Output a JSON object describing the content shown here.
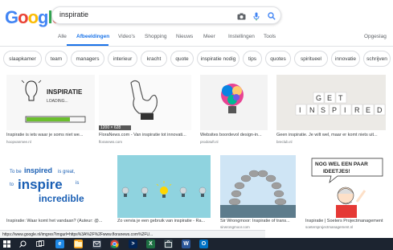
{
  "logo": {
    "letters": [
      "G",
      "o",
      "o",
      "g",
      "l",
      "e"
    ],
    "colors": [
      "#4285F4",
      "#EA4335",
      "#FBBC05",
      "#4285F4",
      "#34A853",
      "#EA4335"
    ]
  },
  "search": {
    "query": "inspiratie"
  },
  "tabs": [
    {
      "label": "Alle"
    },
    {
      "label": "Afbeeldingen"
    },
    {
      "label": "Video's"
    },
    {
      "label": "Shopping"
    },
    {
      "label": "Nieuws"
    },
    {
      "label": "Meer"
    },
    {
      "label": "Instellingen"
    },
    {
      "label": "Tools"
    },
    {
      "label": "Opgeslag"
    }
  ],
  "chips": [
    "slaapkamer",
    "team",
    "managers",
    "interieur",
    "kracht",
    "quote",
    "inspiratie nodig",
    "tips",
    "quotes",
    "spiritueel",
    "innovatie",
    "schrijven"
  ],
  "results": [
    {
      "caption": "Inspiratie is iets waar je soms niet we...",
      "source": "hoopvanmee.nl",
      "thumb_text": "INSPIRATIE LOADING..."
    },
    {
      "caption": "FloraNews.com - Van inspiratie tot innovati...",
      "source": "floranews.com",
      "thumb_text": "1200 × 628"
    },
    {
      "caption": "Websites boordevol design-in...",
      "source": "prodotuft.nl",
      "thumb_text": ""
    },
    {
      "caption": "Geen inspiratie. Je wilt wel, maar er komt niets uit...",
      "source": "breclub.nl",
      "thumb_text": "GET INSPIRED"
    },
    {
      "caption": "Inspiratie: Waar komt het vandaan? (Auteur: @...",
      "source": "",
      "thumb_text": "To be inspired is great, to inspire is incredible"
    },
    {
      "caption": "Zo vervia je een gebruik van inspiratie - Ra...",
      "source": "",
      "thumb_text": ""
    },
    {
      "caption": "Sir Wrongmoor: Inspiratie of trans...",
      "source": "sirwrongmoor.com",
      "thumb_text": ""
    },
    {
      "caption": "Inspiratie | Soeters Projectmanagement",
      "source": "soetersprojectmanagement.nl",
      "thumb_text": "NOG WEL EEN PAAR IDEETJES!"
    }
  ],
  "status_url": "https://www.google.nl/imgres?imgurl=https%3A%2F%2Fwww.floranews.com%2FU...",
  "taskbar": [
    "start-icon",
    "search-icon",
    "task-view-icon",
    "edge-icon",
    "explorer-icon",
    "mail-icon",
    "chrome-icon",
    "powershell-icon",
    "excel-icon",
    "store-icon",
    "word-icon",
    "outlook-icon"
  ]
}
